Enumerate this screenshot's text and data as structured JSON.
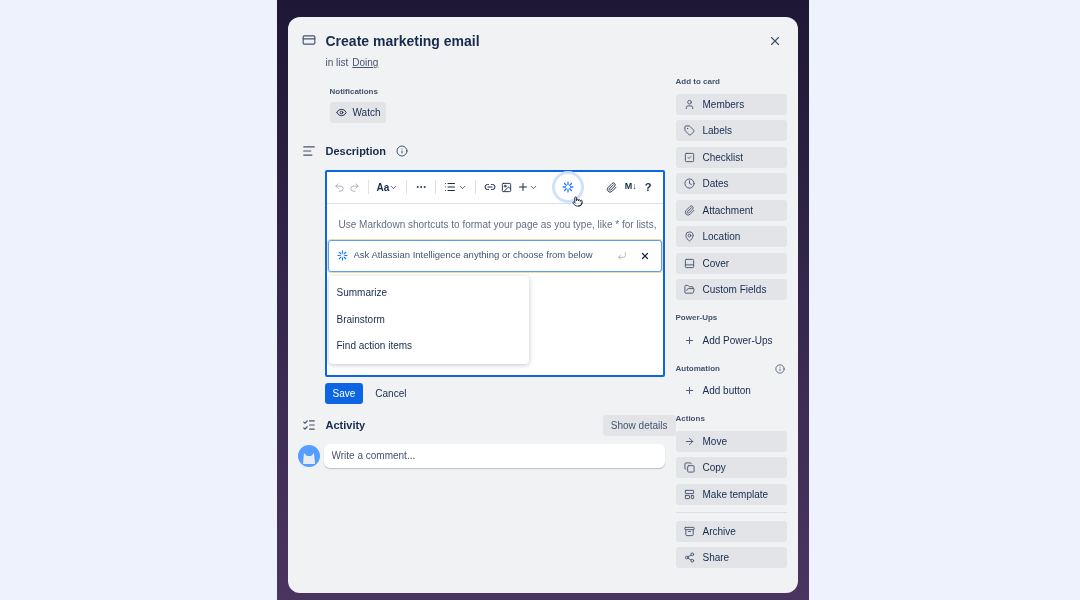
{
  "card": {
    "title": "Create marketing email",
    "list_prefix": "in list",
    "list_name": "Doing"
  },
  "notifications": {
    "label": "Notifications",
    "watch_button": "Watch"
  },
  "description": {
    "title": "Description",
    "toolbar": {
      "text_style": "Aa",
      "markdown": "M↓",
      "help": "?"
    },
    "placeholder": "Use Markdown shortcuts to format your page as you type, like * for lists,",
    "ai_prompt": {
      "placeholder": "Ask Atlassian Intelligence anything or choose from below"
    },
    "ai_suggestions": [
      "Summarize",
      "Brainstorm",
      "Find action items"
    ],
    "save": "Save",
    "cancel": "Cancel"
  },
  "activity": {
    "title": "Activity",
    "show_details": "Show details",
    "comment_placeholder": "Write a comment..."
  },
  "sidebar": [
    {
      "title": "Add to card",
      "kind": "buttons",
      "items": [
        "Members",
        "Labels",
        "Checklist",
        "Dates",
        "Attachment",
        "Location",
        "Cover",
        "Custom Fields"
      ]
    },
    {
      "title": "Power-Ups",
      "kind": "links",
      "items": [
        "Add Power-Ups"
      ]
    },
    {
      "title": "Automation",
      "kind": "links",
      "info": true,
      "items": [
        "Add button"
      ]
    },
    {
      "title": "Actions",
      "kind": "buttons",
      "items": [
        "Move",
        "Copy",
        "Make template"
      ],
      "extra_items": [
        "Archive",
        "Share"
      ]
    }
  ]
}
